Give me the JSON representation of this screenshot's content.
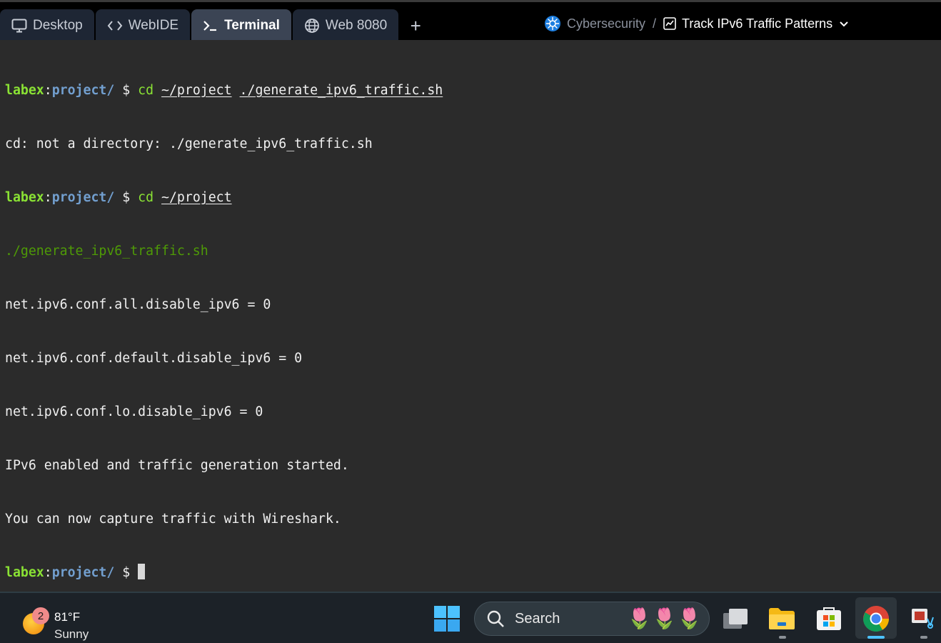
{
  "tabs": [
    {
      "label": "Desktop",
      "icon": "monitor-icon",
      "active": false
    },
    {
      "label": "WebIDE",
      "icon": "code-icon",
      "active": false
    },
    {
      "label": "Terminal",
      "icon": "terminal-icon",
      "active": true
    },
    {
      "label": "Web 8080",
      "icon": "globe-icon",
      "active": false
    }
  ],
  "add_tab_label": "+",
  "breadcrumb": {
    "course": "Cybersecurity",
    "separator": "/",
    "lab": "Track IPv6 Traffic Patterns"
  },
  "terminal": {
    "prompt_user": "labex",
    "prompt_sep": ":",
    "prompt_path": "project/",
    "prompt_dollar": " $ ",
    "lines": [
      {
        "cmd": "cd",
        "args": [
          "~/project",
          "./generate_ipv6_traffic.sh"
        ]
      },
      {
        "text": "cd: not a directory: ./generate_ipv6_traffic.sh"
      },
      {
        "cmd": "cd",
        "args": [
          "~/project"
        ]
      },
      {
        "text": "./generate_ipv6_traffic.sh"
      },
      {
        "text": "net.ipv6.conf.all.disable_ipv6 = 0"
      },
      {
        "text": "net.ipv6.conf.default.disable_ipv6 = 0"
      },
      {
        "text": "net.ipv6.conf.lo.disable_ipv6 = 0"
      },
      {
        "text": "IPv6 enabled and traffic generation started."
      },
      {
        "text": "You can now capture traffic with Wireshark."
      }
    ]
  },
  "taskbar": {
    "weather": {
      "badge": "2",
      "temp": "81°F",
      "condition": "Sunny"
    },
    "search_label": "Search",
    "accent": "#4cc2ff"
  }
}
